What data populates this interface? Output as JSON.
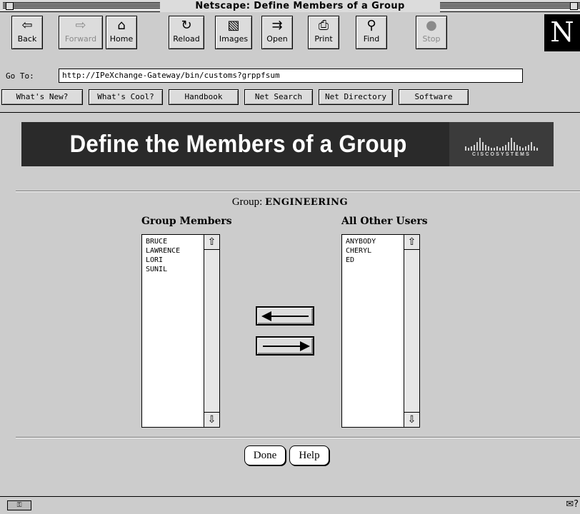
{
  "window": {
    "title": "Netscape: Define Members of a Group"
  },
  "toolbar": {
    "buttons": [
      {
        "label": "Back",
        "icon": "⇦",
        "icon_name": "back-arrow-icon"
      },
      {
        "label": "Forward",
        "icon": "⇨",
        "icon_name": "forward-arrow-icon"
      },
      {
        "label": "Home",
        "icon": "⌂",
        "icon_name": "home-icon"
      },
      {
        "label": "Reload",
        "icon": "↻",
        "icon_name": "reload-icon"
      },
      {
        "label": "Images",
        "icon": "▧",
        "icon_name": "images-icon"
      },
      {
        "label": "Open",
        "icon": "⇉",
        "icon_name": "open-icon"
      },
      {
        "label": "Print",
        "icon": "⎙",
        "icon_name": "print-icon"
      },
      {
        "label": "Find",
        "icon": "⚲",
        "icon_name": "find-icon"
      },
      {
        "label": "Stop",
        "icon": "●",
        "icon_name": "stop-icon"
      }
    ],
    "logo": "N"
  },
  "location": {
    "label": "Go To:",
    "url": "http://IPeXchange-Gateway/bin/customs?grppfsum"
  },
  "directory_buttons": [
    "What's New?",
    "What's Cool?",
    "Handbook",
    "Net Search",
    "Net Directory",
    "Software"
  ],
  "banner": {
    "title": "Define the Members of a Group",
    "logo_text": "CISCOSYSTEMS"
  },
  "group": {
    "label": "Group:",
    "name": "ENGINEERING"
  },
  "members": {
    "heading": "Group Members",
    "items": [
      "BRUCE",
      "LAWRENCE",
      "LORI",
      "SUNIL"
    ]
  },
  "others": {
    "heading": "All Other Users",
    "items": [
      "ANYBODY",
      "CHERYL",
      "ED"
    ]
  },
  "actions": {
    "done": "Done",
    "help": "Help"
  },
  "colors": {
    "chrome": "#cccccc",
    "banner_bg": "#2a2a2a",
    "banner_text": "#ffffff"
  }
}
